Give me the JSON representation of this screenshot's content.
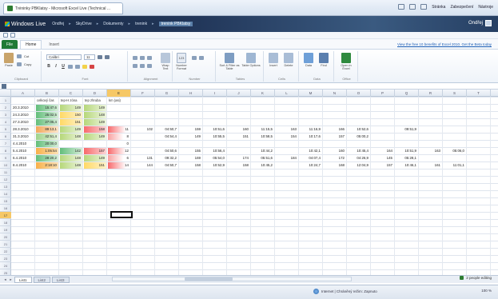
{
  "browser": {
    "tab_title": "Tréninky PBKlatsy - Microsoft Excel Live (Technical ...",
    "commands": [
      "Stránka",
      "Zabezpečení",
      "Nástroje"
    ]
  },
  "windows_live": {
    "brand": "Windows Live",
    "nav": [
      "Ondřej",
      "SkyDrive",
      "Dokumenty",
      "trenink",
      "trenink PBKlatsy"
    ],
    "user": "Ondřej"
  },
  "ribbon": {
    "tabs": [
      "File",
      "Home",
      "Insert"
    ],
    "promo_link": "View the free 10 benefits of Excel 2010. Get the Beta today",
    "clipboard": {
      "paste": "Paste",
      "cut": "Cut",
      "copy": "Copy",
      "label": "Clipboard"
    },
    "font": {
      "name": "Calibri",
      "size": "11",
      "label": "Font"
    },
    "alignment_label": "Alignment",
    "number": {
      "wrap": "Wrap Text",
      "format": "Number Format",
      "label": "Number"
    },
    "tables": {
      "sort": "Sort & Filter as Table",
      "options": "Table Options",
      "label": "Tables"
    },
    "cells": {
      "insert": "Insert",
      "delete": "Delete",
      "label": "Cells"
    },
    "data": {
      "data": "Data",
      "find": "Find",
      "label": "Data"
    },
    "office": {
      "open": "Open in Excel",
      "label": "Office"
    },
    "abc_number": "123"
  },
  "sheet": {
    "columns": [
      "A",
      "B",
      "C",
      "D",
      "E",
      "F",
      "G",
      "H",
      "I",
      "J",
      "K",
      "L",
      "M",
      "N",
      "O",
      "P",
      "Q",
      "R",
      "S",
      "T"
    ],
    "selected_column": "E",
    "selected_row": "17",
    "row_count": 25,
    "headers": [
      "celkový čas",
      "tep-H zóna",
      "tep zhruba",
      "km (asi)"
    ],
    "rows": [
      {
        "cells": [
          "20.3.2010",
          "15:47,6",
          "149",
          "149",
          "",
          "",
          "",
          "",
          "",
          "",
          "",
          "",
          "",
          "",
          "",
          "",
          "",
          "",
          ""
        ]
      },
      {
        "cells": [
          "24.3.2010",
          "25:02,5",
          "150",
          "148",
          "",
          "",
          "",
          "",
          "",
          "",
          "",
          "",
          "",
          "",
          "",
          "",
          "",
          "",
          ""
        ]
      },
      {
        "cells": [
          "27.3.2010",
          "27:05,4",
          "151",
          "149",
          "",
          "",
          "",
          "",
          "",
          "",
          "",
          "",
          "",
          "",
          "",
          "",
          "",
          "",
          ""
        ]
      },
      {
        "cells": [
          "28.3.2010",
          "89:13,1",
          "149",
          "158",
          "11",
          "102",
          "04:50,7",
          "159",
          "10:51,6",
          "160",
          "11:15,5",
          "163",
          "11:16,9",
          "166",
          "10:52,6",
          "",
          "09:51,9",
          "",
          ""
        ]
      },
      {
        "cells": [
          "31.3.2010",
          "42:51,4",
          "148",
          "149",
          "8",
          "",
          "04:54,4",
          "149",
          "10:55,5",
          "151",
          "10:58,5",
          "154",
          "10:17,6",
          "157",
          "05:00,2",
          "",
          "",
          "",
          ""
        ]
      },
      {
        "cells": [
          "4.4.2010",
          "20:00,0",
          "",
          "",
          "0",
          "",
          "",
          "",
          "",
          "",
          "",
          "",
          "",
          "",
          "",
          "",
          "",
          "",
          ""
        ]
      },
      {
        "cells": [
          "5.4.2010",
          "1:05:54",
          "142",
          "157",
          "12",
          "",
          "04:50,6",
          "155",
          "10:56,4",
          "",
          "10:44,2",
          "",
          "10:42,1",
          "160",
          "10:45,4",
          "164",
          "10:51,9",
          "163",
          "05:06,0"
        ]
      },
      {
        "cells": [
          "6.4.2010",
          "28:20,2",
          "148",
          "149",
          "6",
          "131",
          "09:32,2",
          "169",
          "05:54,0",
          "174",
          "05:51,6",
          "184",
          "04:07,4",
          "172",
          "04:26,9",
          "145",
          "05:28,1",
          "",
          ""
        ]
      },
      {
        "cells": [
          "8.4.2010",
          "2:18:10",
          "148",
          "151",
          "14",
          "144",
          "04:50,7",
          "158",
          "10:52,9",
          "158",
          "10:45,2",
          "",
          "10:24,7",
          "168",
          "12:04,9",
          "157",
          "10:46,1",
          "161",
          "11:01,1"
        ]
      }
    ]
  },
  "sheet_tabs": [
    "List1",
    "List2",
    "List3"
  ],
  "status": {
    "editing": "2 people editing",
    "zone": "Internet | Chráněný režim: Zapnuto",
    "zoom": "100 %"
  }
}
